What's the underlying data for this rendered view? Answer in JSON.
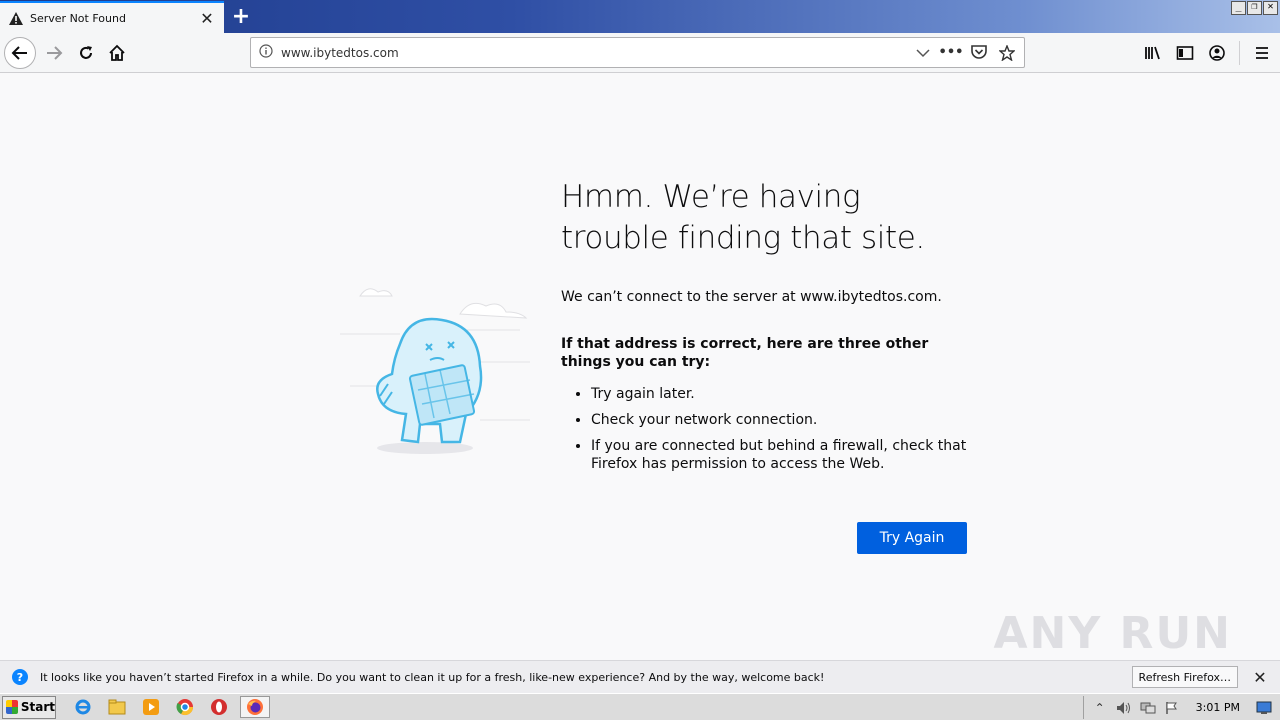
{
  "tab": {
    "title": "Server Not Found"
  },
  "urlbar": {
    "url": "www.ibytedtos.com"
  },
  "error": {
    "title": "Hmm. We’re having trouble finding that site.",
    "message": "We can’t connect to the server at www.ibytedtos.com.",
    "subtitle": "If that address is correct, here are three other things you can try:",
    "suggestions": [
      "Try again later.",
      "Check your network connection.",
      "If you are connected but behind a firewall, check that Firefox has permission to access the Web."
    ],
    "try_again_label": "Try Again"
  },
  "notification": {
    "text": "It looks like you haven’t started Firefox in a while. Do you want to clean it up for a fresh, like-new experience? And by the way, welcome back!",
    "button_label": "Refresh Firefox…"
  },
  "taskbar": {
    "start_label": "Start",
    "clock": "3:01 PM"
  },
  "watermark": "ANY RUN",
  "colors": {
    "accent": "#0060df",
    "tab_highlight": "#0a84ff"
  }
}
